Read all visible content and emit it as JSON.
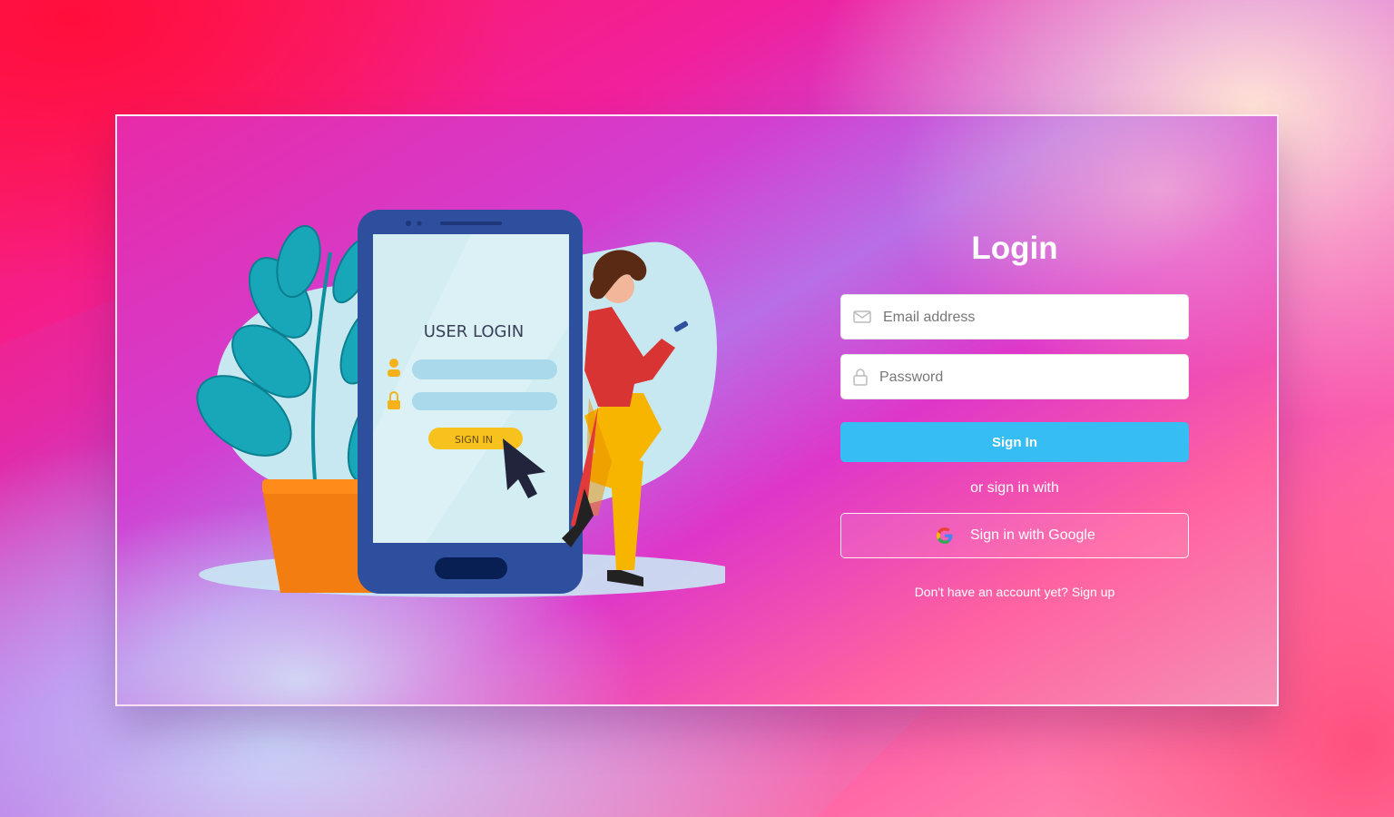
{
  "illustration": {
    "phone_title": "USER LOGIN",
    "phone_button": "SIGN IN"
  },
  "login": {
    "title": "Login",
    "email_placeholder": "Email address",
    "password_placeholder": "Password",
    "sign_in_label": "Sign In",
    "or_text": "or sign in with",
    "google_label": "Sign in with Google",
    "signup_prompt": "Don't have an account yet?",
    "signup_link": "Sign up"
  },
  "icons": {
    "email": "envelope-icon",
    "password": "lock-icon",
    "google": "google-icon"
  },
  "colors": {
    "primary_button": "#35bdf4",
    "field_background": "#ffffff",
    "title_text": "#ffffff"
  }
}
